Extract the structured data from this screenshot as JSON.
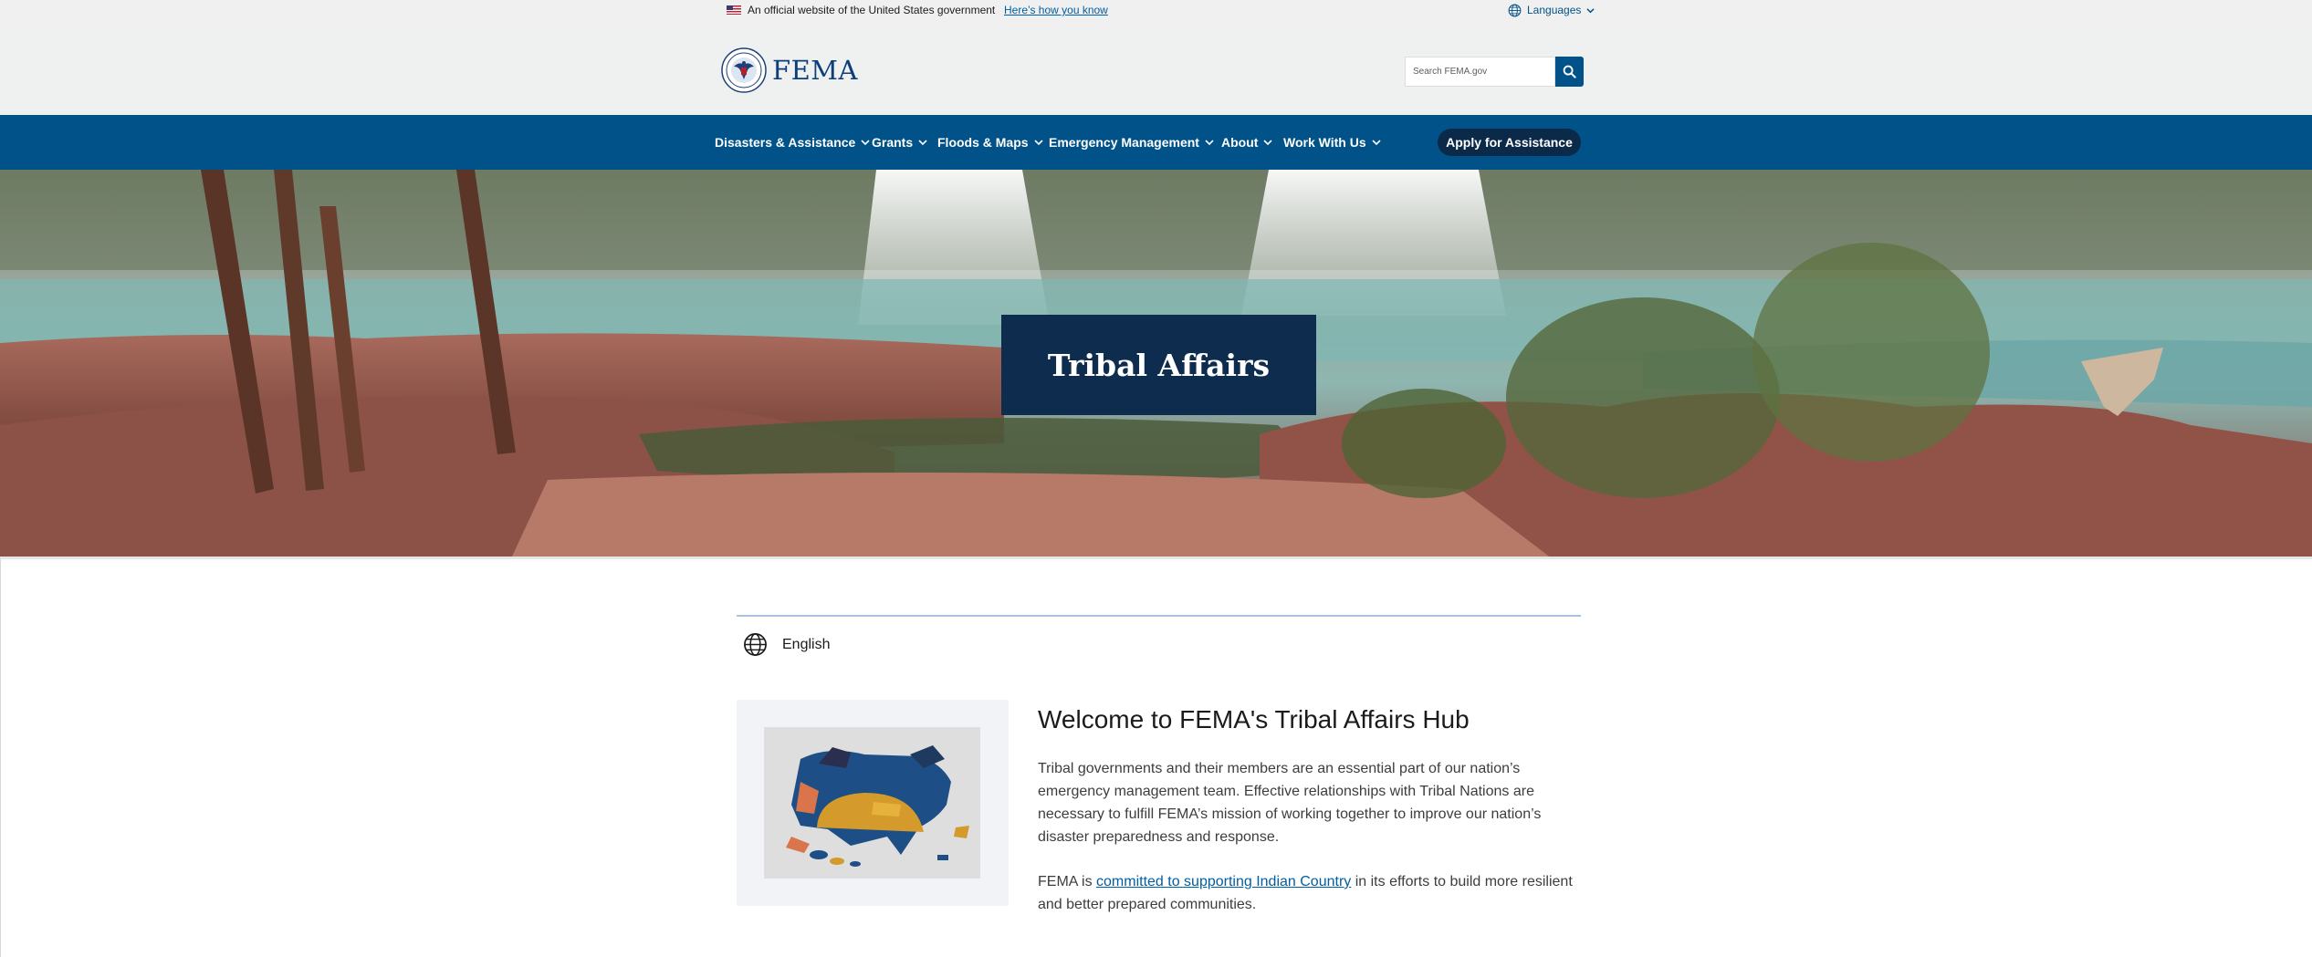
{
  "gov_banner": {
    "official_text": "An official website of the United States government",
    "how_you_know_link": "Here’s how you know",
    "languages_label": "Languages"
  },
  "header": {
    "logo_text": "FEMA",
    "search_placeholder": "Search FEMA.gov"
  },
  "nav": {
    "items": [
      {
        "label": "Disasters & Assistance"
      },
      {
        "label": "Grants"
      },
      {
        "label": "Floods & Maps"
      },
      {
        "label": "Emergency Management"
      },
      {
        "label": "About"
      },
      {
        "label": "Work With Us"
      }
    ],
    "apply_button": "Apply for Assistance"
  },
  "hero": {
    "title": "Tribal Affairs"
  },
  "content": {
    "language_label": "English",
    "welcome_title": "Welcome to FEMA's Tribal Affairs Hub",
    "paragraph1": "Tribal governments and their members are an essential part of our nation’s emergency management team. Effective relationships with Tribal Nations are necessary to fulfill FEMA’s mission of working together to improve our nation’s disaster preparedness and response.",
    "paragraph2_prefix": "FEMA is ",
    "paragraph2_link": "committed to supporting Indian Country",
    "paragraph2_suffix": " in its efforts to build more resilient and better prepared communities."
  },
  "colors": {
    "nav_blue": "#005288",
    "hero_box": "#0e2d4e",
    "link_blue": "#005ea2",
    "header_bg": "#eff0f0"
  },
  "icons": {
    "flag": "us-flag-icon",
    "language": "globe-icon",
    "search": "search-icon",
    "dropdown": "chevron-down-icon"
  }
}
